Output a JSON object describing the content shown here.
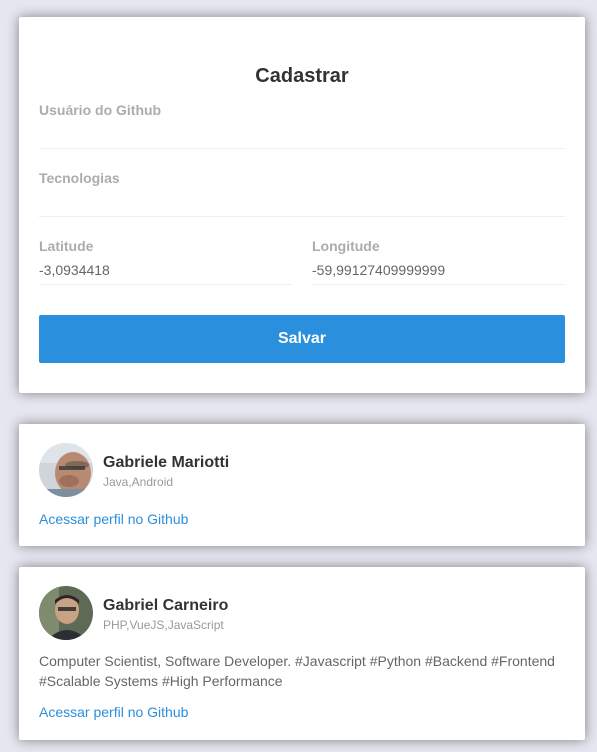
{
  "form": {
    "title": "Cadastrar",
    "github_user": {
      "label": "Usuário do Github",
      "value": ""
    },
    "techs": {
      "label": "Tecnologias",
      "value": ""
    },
    "latitude": {
      "label": "Latitude",
      "value": "-3,0934418"
    },
    "longitude": {
      "label": "Longitude",
      "value": "-59,99127409999999"
    },
    "save_label": "Salvar"
  },
  "devs": [
    {
      "name": "Gabriele Mariotti",
      "techs": "Java,Android",
      "bio": "",
      "link_label": "Acessar perfil no Github"
    },
    {
      "name": "Gabriel Carneiro",
      "techs": "PHP,VueJS,JavaScript",
      "bio": "Computer Scientist, Software Developer. #Javascript #Python #Backend #Frontend #Scalable Systems #High Performance",
      "link_label": "Acessar perfil no Github"
    }
  ],
  "colors": {
    "accent": "#2a8fdd",
    "background": "#e6e6f0",
    "card": "#ffffff",
    "label": "#acacac",
    "text": "#333333",
    "muted": "#999999"
  }
}
